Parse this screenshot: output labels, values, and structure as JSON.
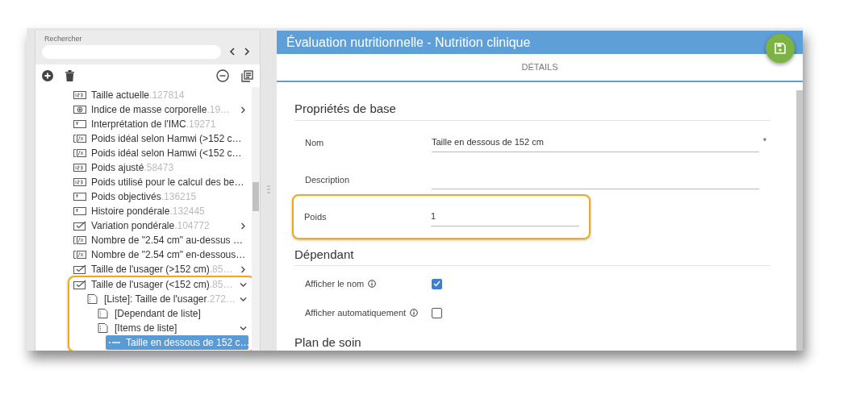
{
  "search": {
    "label": "Rechercher"
  },
  "tree": [
    {
      "kind": "number",
      "label": "Taille actuelle",
      "code": ".127814",
      "selected": false
    },
    {
      "kind": "gauge",
      "label": "Indice de masse corporelle",
      "code": ".19…",
      "expanded": false,
      "selected": false
    },
    {
      "kind": "text",
      "label": "Interprétation de l'IMC",
      "code": ".19271",
      "selected": false
    },
    {
      "kind": "formula",
      "label": "Poids idéal selon Hamwi (>152 c…",
      "selected": false
    },
    {
      "kind": "formula",
      "label": "Poids idéal selon Hamwi (<152 c…",
      "selected": false
    },
    {
      "kind": "number",
      "label": "Poids ajusté",
      "code": ".58473",
      "selected": false
    },
    {
      "kind": "number",
      "label": "Poids utilisé pour le calcul des be…",
      "selected": false
    },
    {
      "kind": "text",
      "label": "Poids objectivés",
      "code": ".136215",
      "selected": false
    },
    {
      "kind": "text",
      "label": "Histoire pondérale",
      "code": ".132445",
      "selected": false
    },
    {
      "kind": "check",
      "label": "Variation pondérale",
      "code": ".104772",
      "expanded": false,
      "selected": false
    },
    {
      "kind": "formula",
      "label": "Nombre de \"2.54 cm\" au-dessus …",
      "selected": false
    },
    {
      "kind": "formula",
      "label": "Nombre de \"2.54 cm\" en-dessous…",
      "selected": false
    },
    {
      "kind": "check",
      "label": "Taille de l'usager (>152 cm)",
      "code": ".85…",
      "expanded": false,
      "selected": false
    },
    {
      "kind": "check",
      "label": "Taille de l'usager (<152 cm)",
      "code": ".85…",
      "expanded": true,
      "selected": false,
      "highlighted": true,
      "children": [
        {
          "kind": "doc",
          "label": "[Liste]: Taille de l'usager",
          "code": ".272…",
          "expanded": true,
          "selected": false,
          "children": [
            {
              "kind": "doc",
              "label": "[Dependant de liste]",
              "selected": false
            },
            {
              "kind": "doc",
              "label": "[Items de liste]",
              "expanded": true,
              "selected": false,
              "children": [
                {
                  "kind": "item",
                  "label": "Taille en dessous de 152 c…",
                  "selected": true
                }
              ]
            }
          ]
        }
      ]
    }
  ],
  "form": {
    "title": "Évaluation nutritionnelle - Nutrition clinique",
    "tabs": [
      {
        "label": "DÉTAILS",
        "selected": true
      }
    ],
    "sections": [
      {
        "title": "Propriétés de base",
        "fields": [
          {
            "kind": "text",
            "label": "Nom",
            "value": "Taille en dessous de 152 cm",
            "required_mark": "*"
          },
          {
            "kind": "text",
            "label": "Description"
          },
          {
            "kind": "number",
            "label": "Poids",
            "value": "1",
            "highlighted": true
          }
        ]
      },
      {
        "title": "Dépendant",
        "fields": [
          {
            "kind": "checkbox",
            "label": "Afficher le nom",
            "info": true,
            "checked": true
          },
          {
            "kind": "checkbox",
            "label": "Afficher automatiquement",
            "info": true,
            "checked": false
          }
        ]
      },
      {
        "title": "Plan de soin"
      }
    ]
  }
}
